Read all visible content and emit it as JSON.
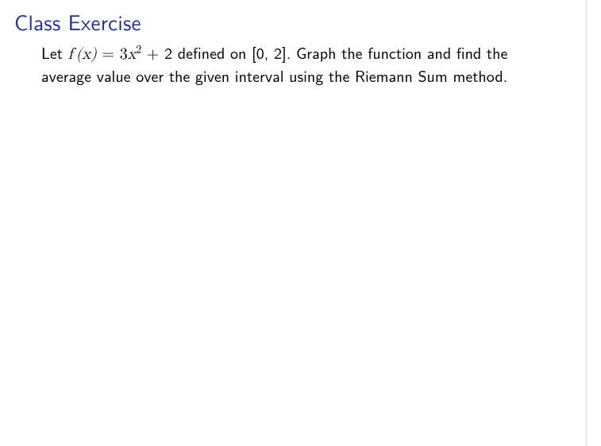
{
  "title": "Class Exercise",
  "body": {
    "pre": "Let ",
    "fx": "f (x)",
    "eq": " = 3",
    "var_x": "x",
    "sq": "2",
    "plus": " + 2 defined on [0, 2]. Graph the function and find the average value over the given interval using the Riemann Sum method."
  }
}
